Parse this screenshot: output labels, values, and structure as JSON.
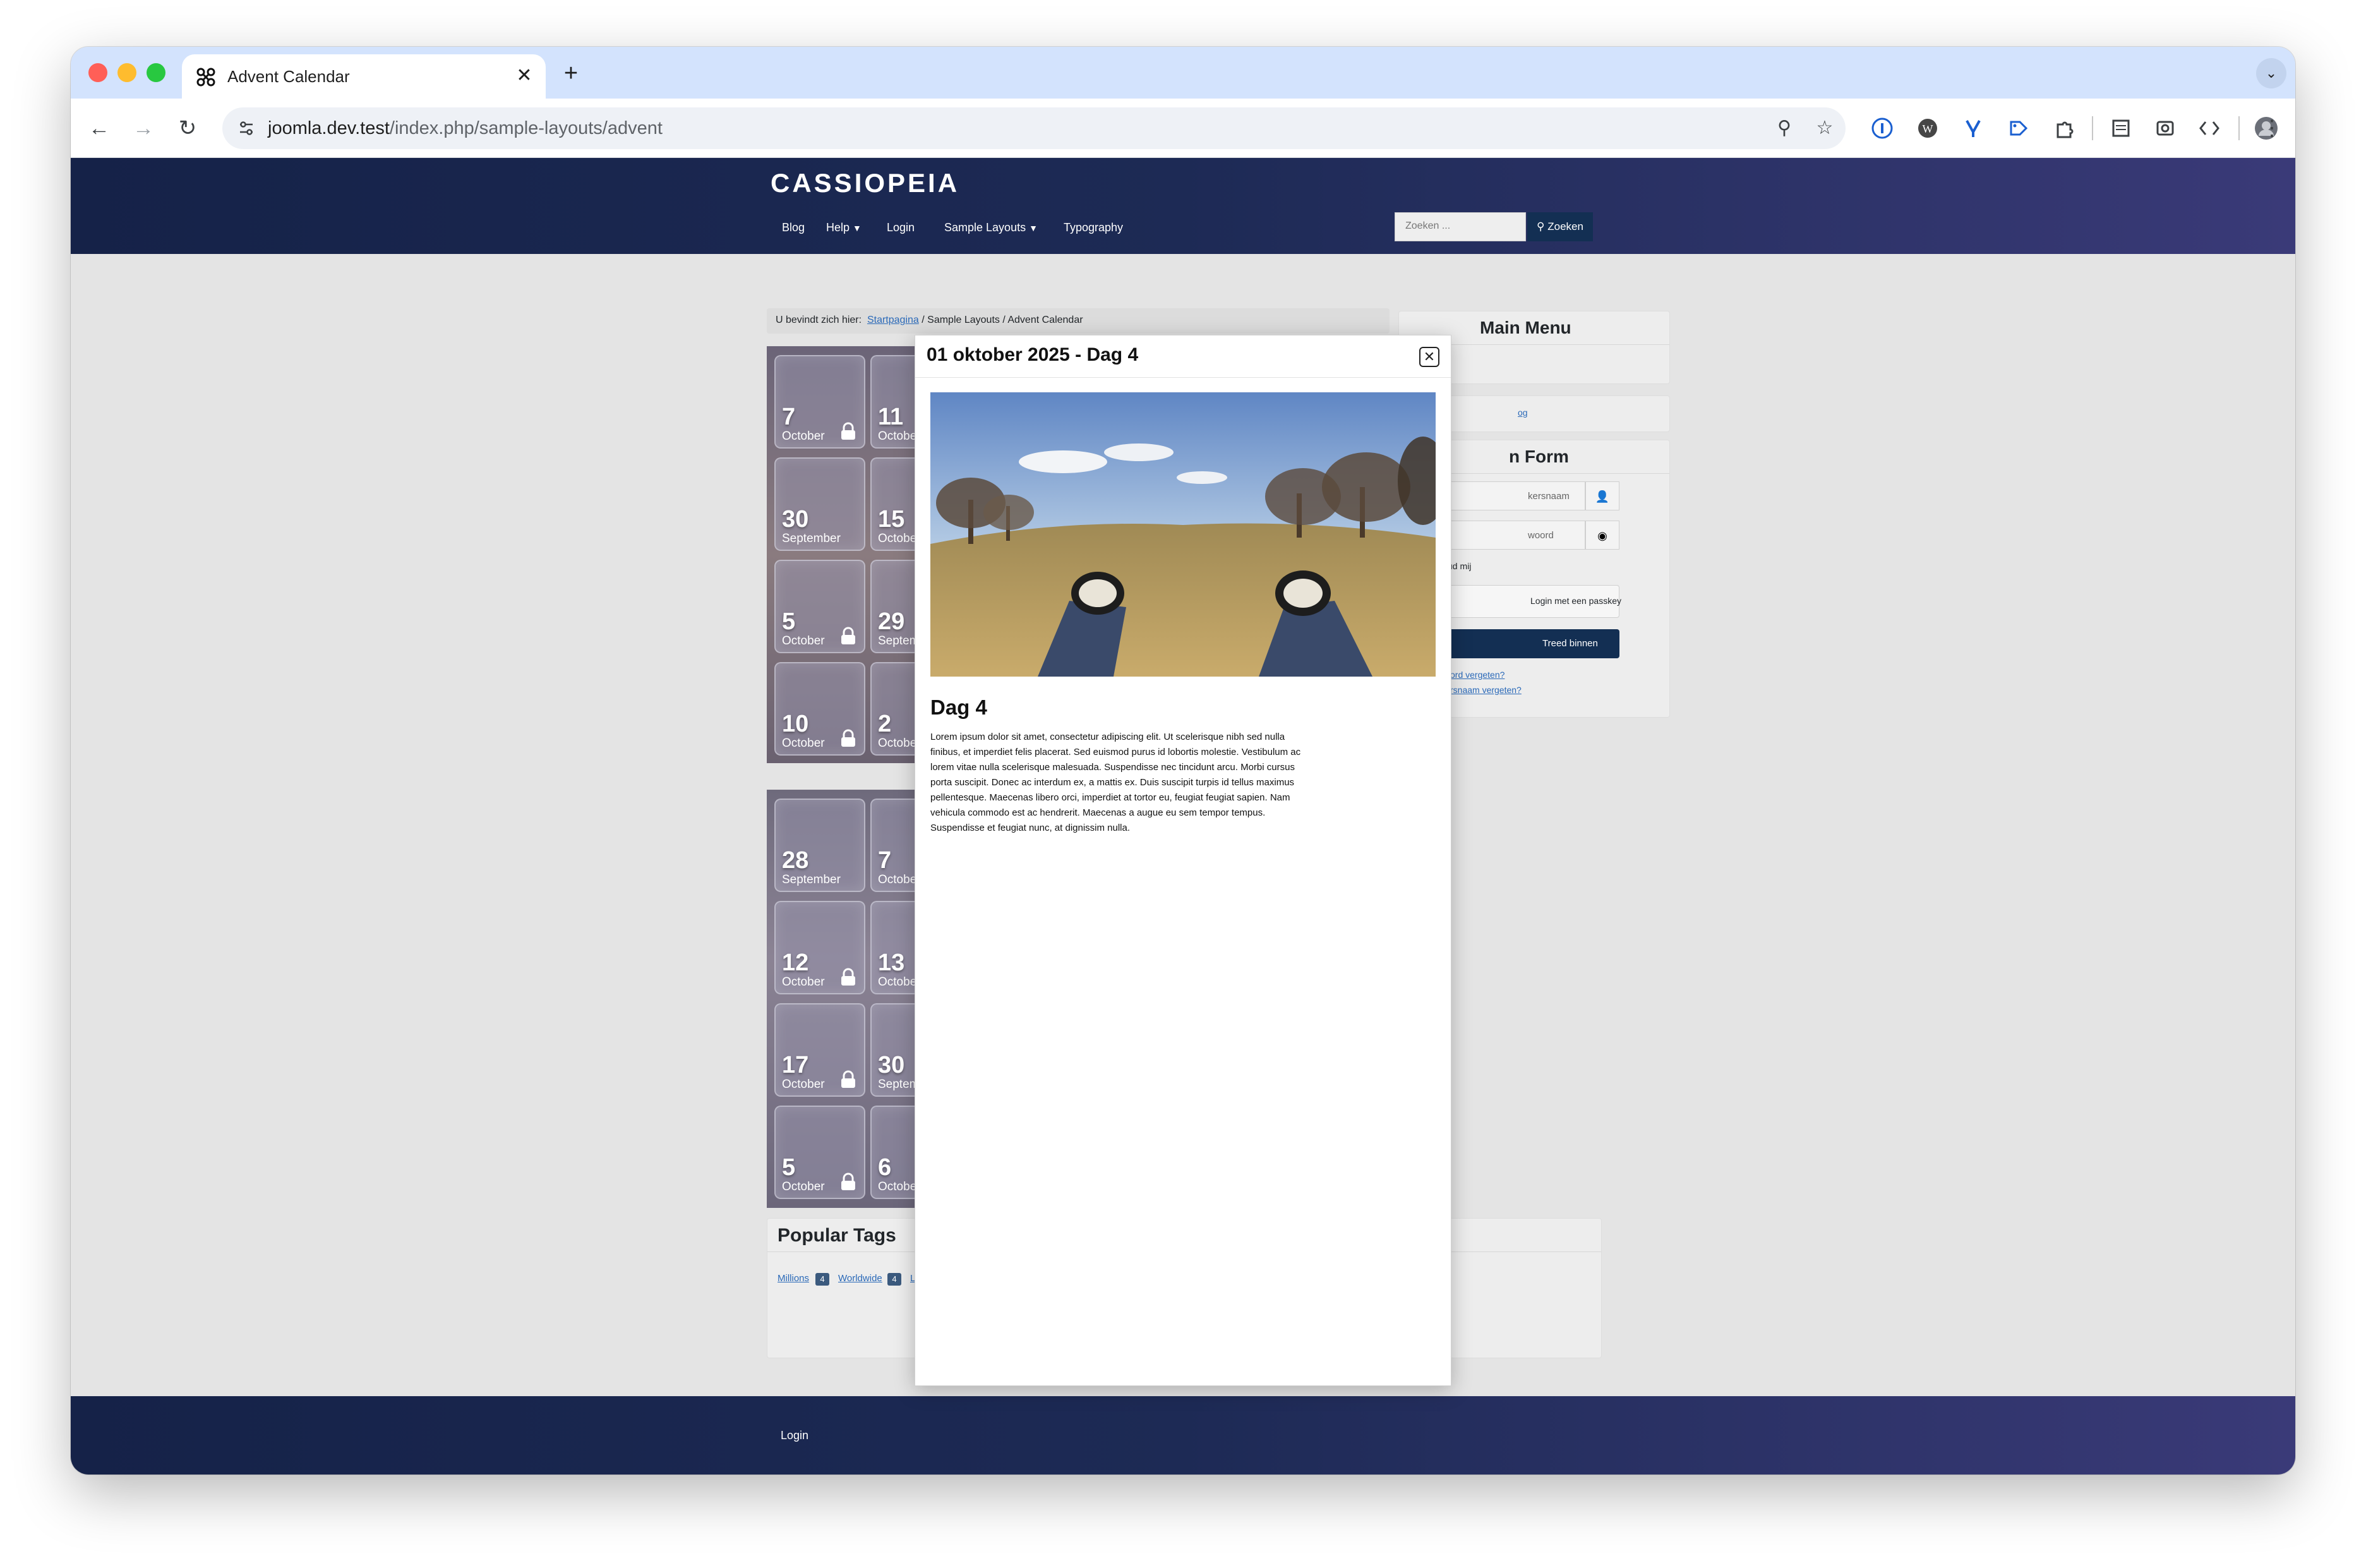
{
  "browser": {
    "tab_title": "Advent Calendar",
    "tab_close": "✕",
    "new_tab": "+",
    "url_host": "joomla.dev.test",
    "url_path": "/index.php/sample-layouts/advent"
  },
  "site": {
    "brand": "CASSIOPEIA",
    "nav": [
      "Blog",
      "Help",
      "Login",
      "Sample Layouts",
      "Typography"
    ],
    "search_placeholder": "Zoeken ...",
    "search_button": "Zoeken",
    "breadcrumb_prefix": "U bevindt zich hier:",
    "breadcrumb_home": "Startpagina",
    "breadcrumb_section": "Sample Layouts",
    "breadcrumb_current": "Advent Calendar",
    "breadcrumb_sep": "/"
  },
  "calendar": {
    "block1": [
      {
        "day": "7",
        "month": "October",
        "locked": true
      },
      {
        "day": "11",
        "month": "October",
        "locked": false
      },
      {
        "day": "30",
        "month": "September",
        "locked": false
      },
      {
        "day": "15",
        "month": "October",
        "locked": false
      },
      {
        "day": "5",
        "month": "October",
        "locked": true
      },
      {
        "day": "29",
        "month": "September",
        "locked": false
      },
      {
        "day": "10",
        "month": "October",
        "locked": true
      },
      {
        "day": "2",
        "month": "October",
        "locked": false
      }
    ],
    "block2": [
      {
        "day": "28",
        "month": "September",
        "locked": false
      },
      {
        "day": "7",
        "month": "October",
        "locked": false
      },
      {
        "day": "12",
        "month": "October",
        "locked": true
      },
      {
        "day": "13",
        "month": "October",
        "locked": false
      },
      {
        "day": "17",
        "month": "October",
        "locked": true
      },
      {
        "day": "30",
        "month": "September",
        "locked": false
      },
      {
        "day": "5",
        "month": "October",
        "locked": true
      },
      {
        "day": "6",
        "month": "October",
        "locked": false
      }
    ]
  },
  "sidebar": {
    "main_menu_title": "Main Menu",
    "main_menu_item": "og",
    "login_title": "n Form",
    "username_placeholder": "kersnaam",
    "password_placeholder": "woord",
    "remember": "ud mij",
    "passkey": "Login met een passkey",
    "submit": "Treed binnen",
    "forgot_password": "ord vergeten?",
    "forgot_username": "rsnaam vergeten?"
  },
  "tags": {
    "title": "Popular Tags",
    "items": [
      {
        "label": "Millions",
        "count": "4"
      },
      {
        "label": "Worldwide",
        "count": "4"
      },
      {
        "label": "L",
        "count": ""
      }
    ]
  },
  "modal": {
    "title": "01 oktober 2025 - Dag 4",
    "close": "✕",
    "heading": "Dag 4",
    "body": "Lorem ipsum dolor sit amet, consectetur adipiscing elit. Ut scelerisque nibh sed nulla finibus, et imperdiet felis placerat. Sed euismod purus id lobortis molestie. Vestibulum ac lorem vitae nulla scelerisque malesuada. Suspendisse nec tincidunt arcu. Morbi cursus porta suscipit. Donec ac interdum ex, a mattis ex. Duis suscipit turpis id tellus maximus pellentesque. Maecenas libero orci, imperdiet at tortor eu, feugiat feugiat sapien. Nam vehicula commodo est ac hendrerit. Maecenas a augue eu sem tempor tempus. Suspendisse et feugiat nunc, at dignissim nulla."
  },
  "footer": {
    "login": "Login"
  },
  "colors": {
    "header_dark": "#152248",
    "header_light": "#3a3a78",
    "button_dark": "#132f53",
    "link": "#2a69b8"
  }
}
